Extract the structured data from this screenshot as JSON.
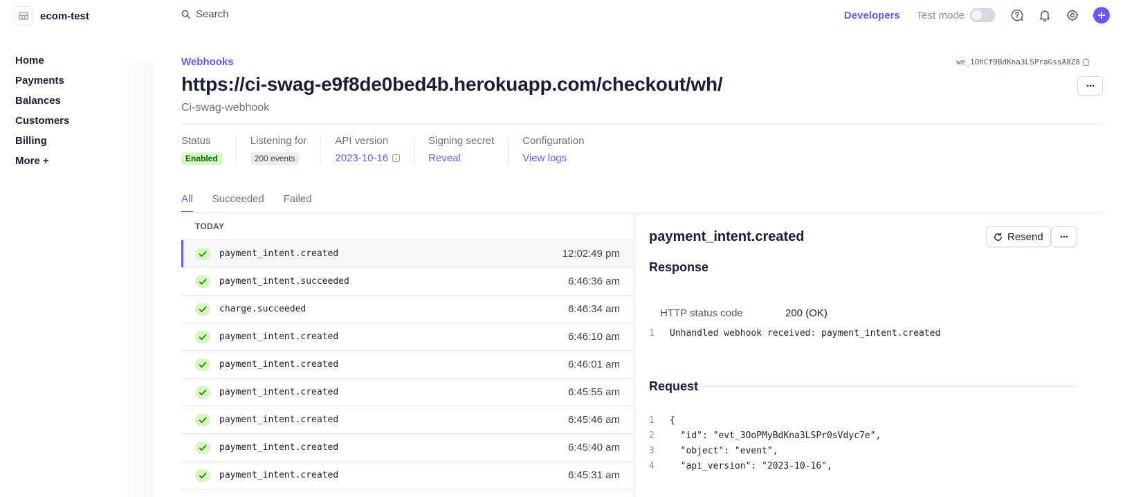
{
  "brand": {
    "name": "ecom-test"
  },
  "nav": {
    "items": [
      "Home",
      "Payments",
      "Balances",
      "Customers",
      "Billing"
    ],
    "more": "More"
  },
  "topbar": {
    "search_placeholder": "Search",
    "developers": "Developers",
    "test_mode": "Test mode"
  },
  "header": {
    "breadcrumb": "Webhooks",
    "endpoint_id": "we_1OhCf9BdKna3LSPraGssA8Z8",
    "title": "https://ci-swag-e9f8de0bed4b.herokuapp.com/checkout/wh/",
    "subtitle": "Ci-swag-webhook"
  },
  "stats": {
    "status_label": "Status",
    "status_value": "Enabled",
    "listening_label": "Listening for",
    "listening_value": "200 events",
    "api_label": "API version",
    "api_value": "2023-10-16",
    "secret_label": "Signing secret",
    "secret_value": "Reveal",
    "config_label": "Configuration",
    "config_value": "View logs"
  },
  "tabs": [
    "All",
    "Succeeded",
    "Failed"
  ],
  "events": {
    "group_label": "TODAY",
    "rows": [
      {
        "name": "payment_intent.created",
        "time": "12:02:49 pm"
      },
      {
        "name": "payment_intent.succeeded",
        "time": "6:46:36 am"
      },
      {
        "name": "charge.succeeded",
        "time": "6:46:34 am"
      },
      {
        "name": "payment_intent.created",
        "time": "6:46:10 am"
      },
      {
        "name": "payment_intent.created",
        "time": "6:46:01 am"
      },
      {
        "name": "payment_intent.created",
        "time": "6:45:55 am"
      },
      {
        "name": "payment_intent.created",
        "time": "6:45:46 am"
      },
      {
        "name": "payment_intent.created",
        "time": "6:45:40 am"
      },
      {
        "name": "payment_intent.created",
        "time": "6:45:31 am"
      },
      {
        "name": "",
        "time": ""
      }
    ]
  },
  "detail": {
    "title": "payment_intent.created",
    "resend": "Resend",
    "response_heading": "Response",
    "http_status_label": "HTTP status code",
    "http_status_value": "200 (OK)",
    "response_line_no": "1",
    "response_body": "Unhandled webhook received: payment_intent.created",
    "request_heading": "Request",
    "request_lines": [
      {
        "ln": "1",
        "key": "{",
        "val": ""
      },
      {
        "ln": "2",
        "key": "  \"id\": ",
        "val": "\"evt_3OoPMyBdKna3LSPr0sVdyc7e\""
      },
      {
        "ln": "3",
        "key": "  \"object\": ",
        "val": "\"event\""
      },
      {
        "ln": "4",
        "key": "  \"api_version\": ",
        "val": "\"2023-10-16\""
      }
    ]
  },
  "colors": {
    "accent": "#635bff",
    "success_bg": "#d7f7c2",
    "success_fg": "#05690d"
  }
}
